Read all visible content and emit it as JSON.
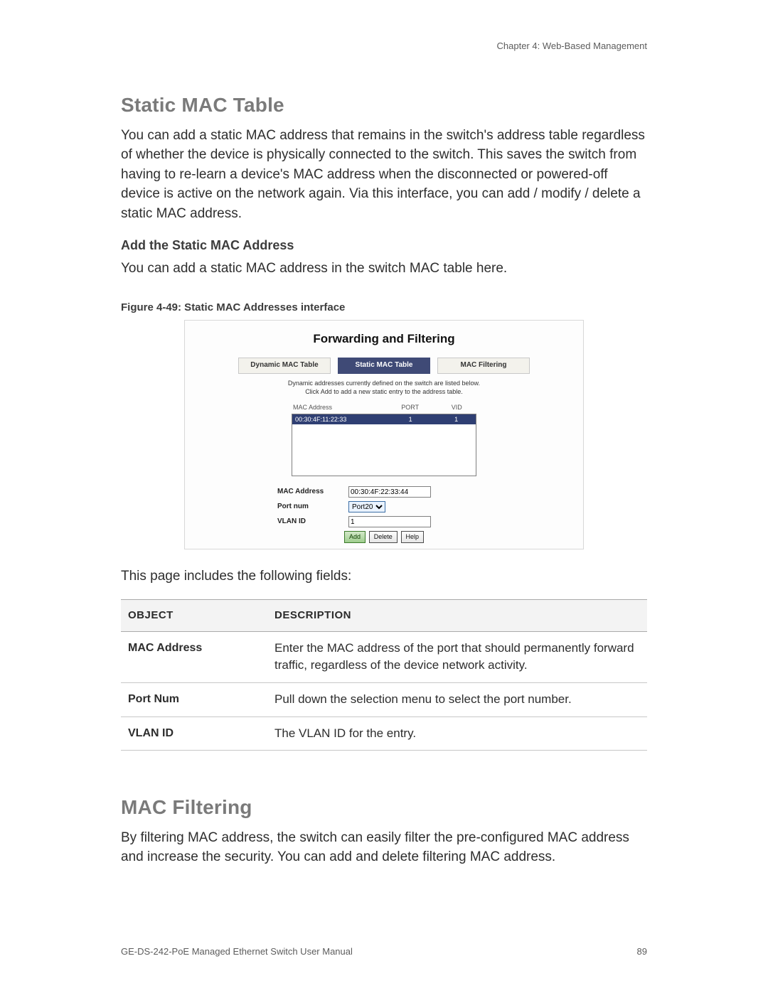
{
  "chapter_header": "Chapter 4: Web-Based Management",
  "section1": {
    "title": "Static MAC Table",
    "body": "You can add a static MAC address that remains in the switch's address table regardless of whether the device is physically connected to the switch. This saves the switch from having to re-learn a device's MAC address when the disconnected or powered-off device is active on the network again. Via this interface, you can add / modify / delete a static MAC address.",
    "sub_heading": "Add the Static MAC Address",
    "sub_body": "You can add a static MAC address in the switch MAC table here.",
    "figure_caption": "Figure 4-49: Static MAC Addresses interface"
  },
  "screenshot": {
    "title": "Forwarding and Filtering",
    "tabs": [
      "Dynamic MAC Table",
      "Static MAC Table",
      "MAC Filtering"
    ],
    "active_tab_index": 1,
    "note_line1": "Dynamic addresses currently defined on the switch are listed below.",
    "note_line2": "Click Add to add a new static entry to the address table.",
    "list_headers": {
      "mac": "MAC Address",
      "port": "PORT",
      "vid": "VID"
    },
    "list_rows": [
      {
        "mac": "00:30:4F:11:22:33",
        "port": "1",
        "vid": "1"
      }
    ],
    "form": {
      "mac_label": "MAC Address",
      "mac_value": "00:30:4F:22:33:44",
      "port_label": "Port num",
      "port_value": "Port20",
      "vlan_label": "VLAN ID",
      "vlan_value": "1"
    },
    "buttons": {
      "add": "Add",
      "delete": "Delete",
      "help": "Help"
    }
  },
  "fields_intro": "This page includes the following fields:",
  "fields_table": {
    "headers": {
      "object": "OBJECT",
      "description": "DESCRIPTION"
    },
    "rows": [
      {
        "object": "MAC Address",
        "description": "Enter the MAC address of the port that should permanently forward traffic, regardless of the device network activity."
      },
      {
        "object": "Port Num",
        "description": "Pull down the selection menu to select the port number."
      },
      {
        "object": "VLAN ID",
        "description": "The VLAN ID for the entry."
      }
    ]
  },
  "section2": {
    "title": "MAC Filtering",
    "body": "By filtering MAC address, the switch can easily filter the pre-configured MAC address and increase the security. You can add and delete filtering MAC address."
  },
  "footer": {
    "left": "GE-DS-242-PoE Managed Ethernet Switch User Manual",
    "right": "89"
  }
}
